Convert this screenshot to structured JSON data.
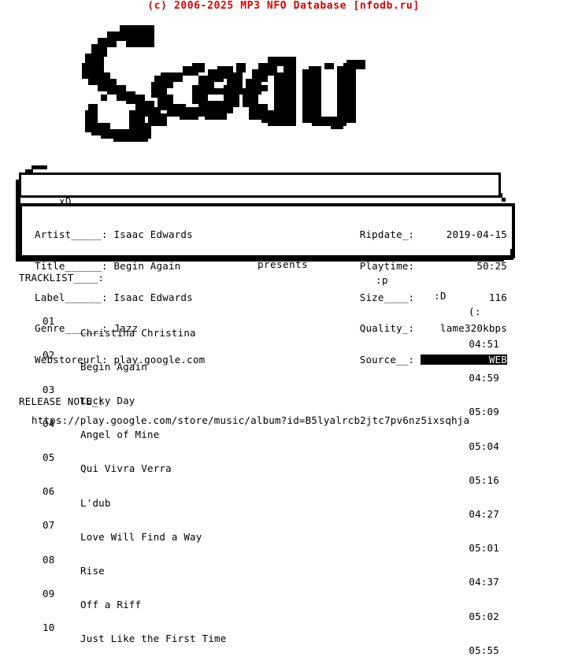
{
  "header": {
    "copyright": "(c) 2006-2025 MP3 NFO Database [nfodb.ru]",
    "color": "#e00000"
  },
  "logo": {
    "text": "Sceau",
    "style": "pixel-block-ascii-art",
    "color": "#000000"
  },
  "presents_bar": {
    "emote_1": "xD",
    "emote_2": ";)",
    "emote_3": ":)",
    "emote_4": "-_-",
    "presents_label": "presents",
    "emote_5": ":p",
    "emote_6": ":D",
    "emote_7": "(:"
  },
  "info": {
    "left": [
      {
        "label": "Artist_____:",
        "value": "Isaac Edwards"
      },
      {
        "label": "Title______:",
        "value": "Begin Again"
      },
      {
        "label": "Label______:",
        "value": "Isaac Edwards"
      },
      {
        "label": "Genre______:",
        "value": "Jazz"
      },
      {
        "label": "Webstoreurl:",
        "value": "play.google.com"
      }
    ],
    "right": [
      {
        "label": "Ripdate_:",
        "value": "2019-04-15",
        "inverted": false
      },
      {
        "label": "Playtime:",
        "value": "50:25",
        "inverted": false
      },
      {
        "label": "Size____:",
        "value": "116",
        "inverted": false
      },
      {
        "label": "Quality_:",
        "value": "lame320kbps",
        "inverted": false
      },
      {
        "label": "Source__:",
        "value": "WEB",
        "inverted": true
      }
    ]
  },
  "tracklist": {
    "heading": "TRACKLIST____:",
    "tracks": [
      {
        "num": "01",
        "title": "Christina Christina",
        "time": "04:51"
      },
      {
        "num": "02",
        "title": "Begin Again",
        "time": "04:59"
      },
      {
        "num": "03",
        "title": "Lucky Day",
        "time": "05:09"
      },
      {
        "num": "04",
        "title": "Angel of Mine",
        "time": "05:04"
      },
      {
        "num": "05",
        "title": "Qui Vivra Verra",
        "time": "05:16"
      },
      {
        "num": "06",
        "title": "L'dub",
        "time": "04:27"
      },
      {
        "num": "07",
        "title": "Love Will Find a Way",
        "time": "05:01"
      },
      {
        "num": "08",
        "title": "Rise",
        "time": "04:37"
      },
      {
        "num": "09",
        "title": "Off a Riff",
        "time": "05:02"
      },
      {
        "num": "10",
        "title": "Just Like the First Time",
        "time": "05:55"
      }
    ]
  },
  "release_note": {
    "heading": "RELEASE NOTE_:",
    "url": "https://play.google.com/store/music/album?id=B5lyalrcb2jtc7pv6nz5ixsqhja"
  }
}
